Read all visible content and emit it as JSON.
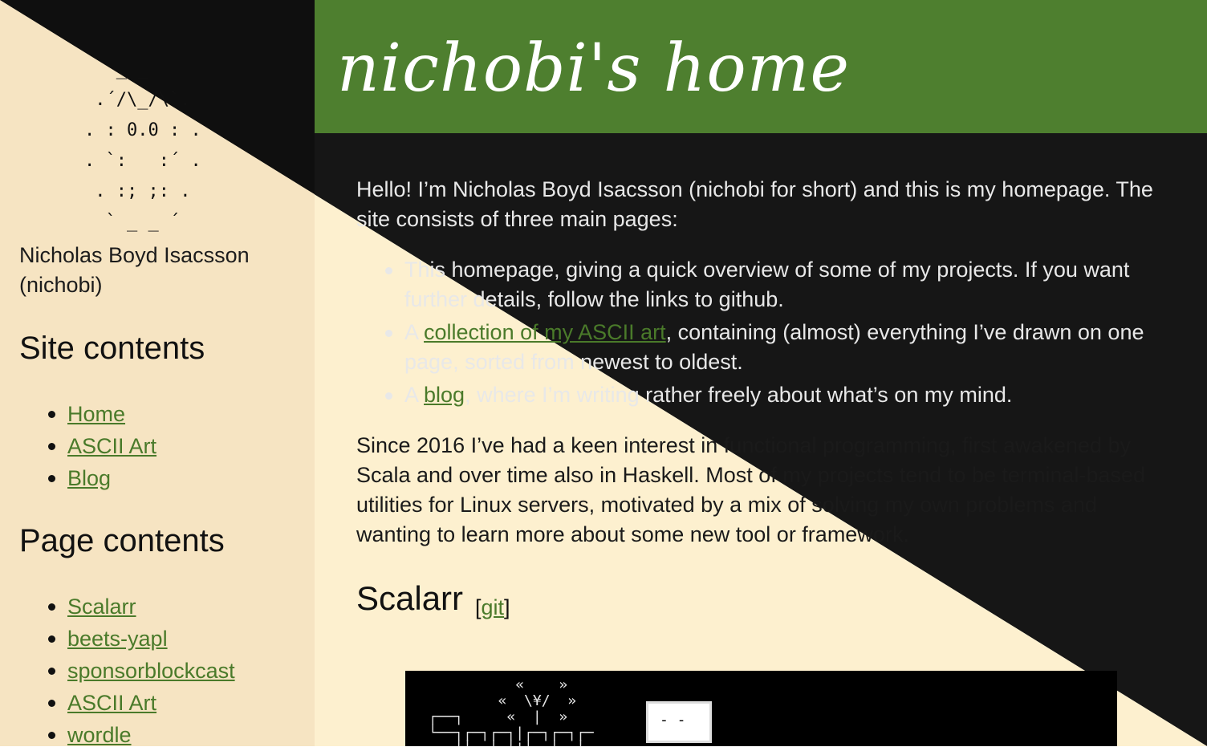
{
  "colors": {
    "cream": "#f6e4c2",
    "cream_main": "#fdf0cf",
    "dark": "#161616",
    "header_green": "#4e7f2f",
    "link_green": "#4a7a2a"
  },
  "sidebar": {
    "ascii_logo": "   _ _\n .´/\\_/\\`.\n. : 0.0 : .\n. `:   :´ .\n . :; ;: .\n  ` _ _ ´",
    "author_name": "Nicholas Boyd Isacsson (nichobi)",
    "site_contents_heading": "Site contents",
    "site_contents": [
      "Home",
      "ASCII Art",
      "Blog"
    ],
    "page_contents_heading": "Page contents",
    "page_contents": [
      "Scalarr",
      "beets-yapl",
      "sponsorblockcast",
      "ASCII Art",
      "wordle"
    ]
  },
  "header": {
    "title": "nichobi's home"
  },
  "main": {
    "intro": "Hello! I’m Nicholas Boyd Isacsson (nichobi for short) and this is my homepage. The site consists of three main pages:",
    "list": {
      "item1": "This homepage, giving a quick overview of some of my projects. If you want further details, follow the links to github.",
      "item2_prefix": "A ",
      "item2_link": "collection of my ASCII art",
      "item2_suffix": ", containing (almost) everything I’ve drawn on one page, sorted from newest to oldest.",
      "item3_prefix": "A ",
      "item3_link": "blog",
      "item3_suffix": ", where I’m writing rather freely about what’s on my mind."
    },
    "para2": "Since 2016 I’ve had a keen interest in functional programming, first awakened by Scala and over time also in Haskell. Most of my projects tend to be terminal-based utilities for Linux servers, motivated by a mix of solving my own problems and wanting to learn more about some new tool or framework.",
    "section_title": "Scalarr",
    "git_open": "[",
    "git_label": "git",
    "git_close": "]"
  },
  "banner": {
    "ascii": "           «    »\n         «  \\¥/  »\n ┌──┐     «  |  »\n └──┐┌─┐┌─┐|┌─┐┌─┐┌─\n ───┘└─ └─┘|└─ └─ └ ",
    "tv_face": "- -"
  }
}
